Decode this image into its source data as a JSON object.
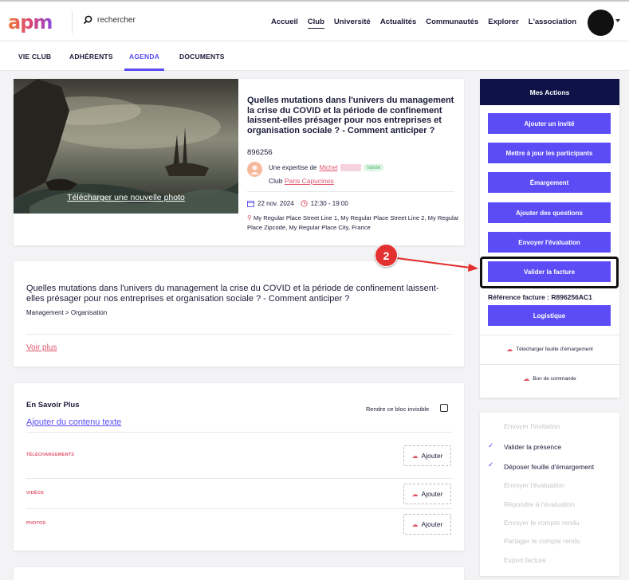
{
  "header": {
    "logo": "apm",
    "search_placeholder": "rechercher",
    "nav": [
      "Accueil",
      "Club",
      "Université",
      "Actualités",
      "Communautés",
      "Explorer",
      "L'association"
    ],
    "nav_active": "Club"
  },
  "subnav": {
    "tabs": [
      "VIE CLUB",
      "ADHÉRENTS",
      "AGENDA",
      "DOCUMENTS"
    ],
    "active": "AGENDA"
  },
  "event": {
    "photo_link": "Télécharger une nouvelle photo",
    "title": "Quelles mutations dans l'univers du management la crise du COVID et la période de confinement laissent-elles présager pour nos entreprises et organisation sociale ? - Comment anticiper ?",
    "id": "896256",
    "expertise_prefix": "Une expertise de",
    "expert_name": "Michel",
    "badge": "Validé",
    "club_prefix": "Club",
    "club_name": "Paris Capucines",
    "date": "22 nov. 2024",
    "time": "12:30 - 19:00",
    "address": "My Regular Place Street Line 1, My Regular Place Street Line 2, My Regular Place Zipcode, My Regular Place City, France"
  },
  "description": {
    "title": "Quelles mutations dans l'univers du management la crise du COVID et la période de confinement laissent-elles présager pour nos entreprises et organisation sociale ? - Comment anticiper ?",
    "category": "Management > Organisation",
    "more": "Voir plus"
  },
  "savoir_plus": {
    "title": "En Savoir Plus",
    "invisible_label": "Rendre ce bloc invisible",
    "add_text": "Ajouter du contenu texte",
    "sections": [
      {
        "label": "TÉLÉCHARGEMENTS",
        "button": "Ajouter"
      },
      {
        "label": "VIDÉOS",
        "button": "Ajouter"
      },
      {
        "label": "PHOTOS",
        "button": "Ajouter"
      }
    ]
  },
  "actions": {
    "title": "Mes Actions",
    "buttons": [
      "Ajouter un invité",
      "Mettre à jour les participants",
      "Émargement",
      "Ajouter des questions",
      "Envoyer l'évaluation",
      "Valider la facture"
    ],
    "reference": "Référence facture : R896256AC1",
    "logistics": "Logistique",
    "download_sheet": "Télécharger feuille d'émargement",
    "purchase_order": "Bon de commande"
  },
  "steps": [
    {
      "label": "Envoyer l'invitation",
      "done": false
    },
    {
      "label": "Valider la présence",
      "done": true
    },
    {
      "label": "Déposer feuille d'émargement",
      "done": true
    },
    {
      "label": "Envoyer l'évaluation",
      "done": false
    },
    {
      "label": "Répondre à l'évaluation",
      "done": false
    },
    {
      "label": "Envoyer le compte rendu",
      "done": false
    },
    {
      "label": "Partager le compte rendu",
      "done": false
    },
    {
      "label": "Export facture",
      "done": false
    }
  ],
  "annotation": {
    "number": "2"
  },
  "colors": {
    "accent": "#5b4cf5",
    "navy": "#0e1247",
    "pink": "#e0546c",
    "marker": "#e33030"
  }
}
